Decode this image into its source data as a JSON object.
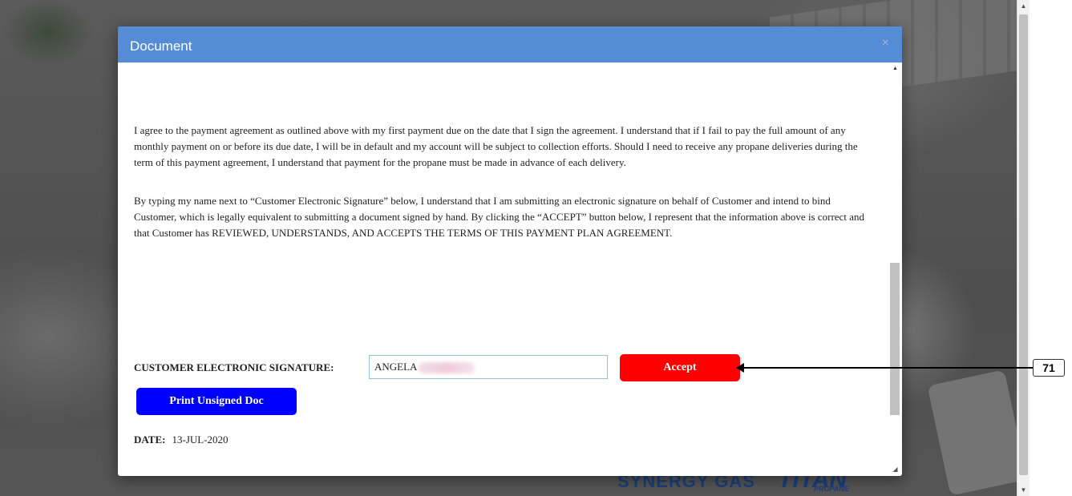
{
  "modal": {
    "title": "Document",
    "close_glyph": "×",
    "paragraphs": [
      "I agree to the payment agreement as outlined above with my first payment due on the date that I sign the agreement. I understand that if I fail to pay the full amount of any monthly payment on or before its due date, I will be in default and my account will be subject to collection efforts. Should I need to receive any propane deliveries during the term of this payment agreement, I understand that payment for the propane must be made in advance of each delivery.",
      "By typing my name next to “Customer Electronic Signature” below, I understand that I am submitting an electronic signature on behalf of Customer and intend to bind Customer, which is legally equivalent to submitting a document signed by hand. By clicking the “ACCEPT” button below, I represent that the information above is correct and that Customer has REVIEWED, UNDERSTANDS, AND ACCEPTS THE TERMS OF THIS PAYMENT PLAN AGREEMENT."
    ],
    "signature": {
      "label": "CUSTOMER ELECTRONIC SIGNATURE:",
      "value": "ANGELA"
    },
    "accept_label": "Accept",
    "print_label": "Print Unsigned Doc",
    "date": {
      "label": "DATE:",
      "value": "13-JUL-2020"
    }
  },
  "background": {
    "logo_left": "SYNERGY GAS",
    "logo_right": "TITAN",
    "logo_right_sub": "PROPANE"
  },
  "annotation": {
    "badge": "71"
  },
  "icons": {
    "close": "close-icon",
    "scroll_up": "scroll-up-arrow-icon",
    "scroll_down": "scroll-down-arrow-icon",
    "resize": "resize-grip-icon"
  },
  "colors": {
    "header": "#558cd6",
    "accept": "#ff0000",
    "print": "#0000ff"
  }
}
